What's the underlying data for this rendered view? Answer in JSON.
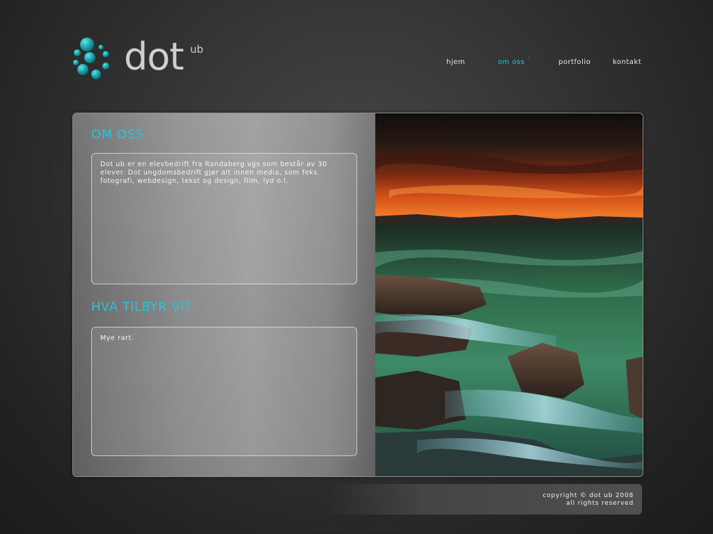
{
  "logo": {
    "word": "dot",
    "superscript": "ub",
    "dot_color": "#1fa5b0"
  },
  "nav": {
    "items": [
      {
        "label": "hjem",
        "active": false
      },
      {
        "label": "om oss",
        "active": true
      },
      {
        "label": "portfolio",
        "active": false
      },
      {
        "label": "kontakt",
        "active": false
      }
    ],
    "active_marker": "˺",
    "accent_color": "#27c5d3"
  },
  "sections": {
    "about": {
      "title": "OM OSS",
      "body": "Dot ub er en elevbedrift fra Randaberg vgs som består av 30 elever. Dot ungdomsbedrift gjør alt innen media, som feks. fotografi, webdesign, tekst og design, film, lyd o.l."
    },
    "offer": {
      "title": "HVA TILBYR VI?",
      "body": "Mye rart."
    }
  },
  "footer": {
    "line1": "copyright © dot ub 2008",
    "line2": "all rights reserved"
  }
}
